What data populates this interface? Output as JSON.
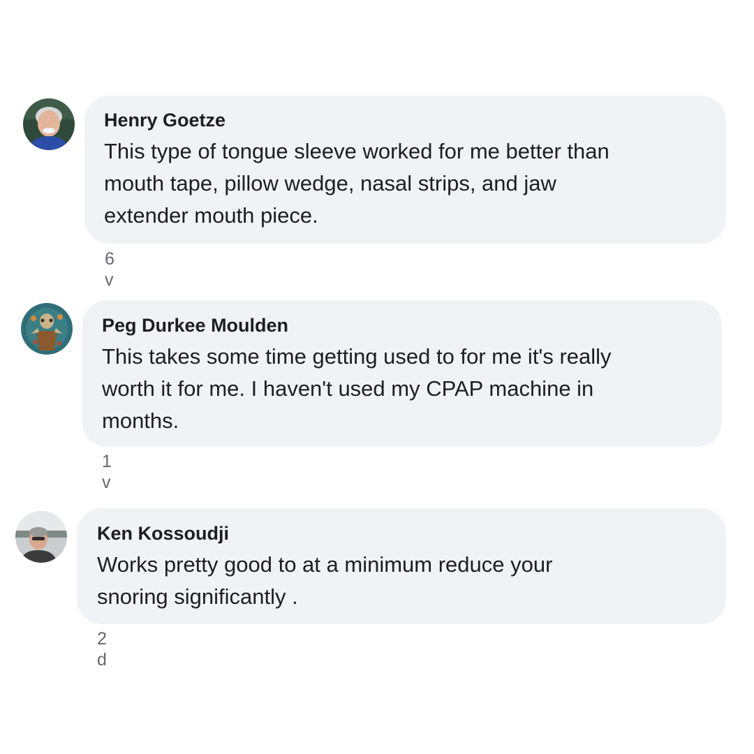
{
  "comments": [
    {
      "author": "Henry Goetze",
      "text": "This type of tongue sleeve worked for me better than\nmouth tape, pillow wedge, nasal strips, and jaw\nextender mouth piece.",
      "time": "6 v"
    },
    {
      "author": "Peg Durkee Moulden",
      "text": "This takes some time getting used to for me it's really\nworth it for me.  I haven't used my CPAP machine in\nmonths.",
      "time": "1 v"
    },
    {
      "author": "Ken Kossoudji",
      "text": "Works pretty good to at a minimum reduce your\nsnoring significantly .",
      "time": "2 d"
    }
  ],
  "colors": {
    "bubble": "#f0f2f5",
    "text": "#1c1e21",
    "meta": "#65676b"
  }
}
